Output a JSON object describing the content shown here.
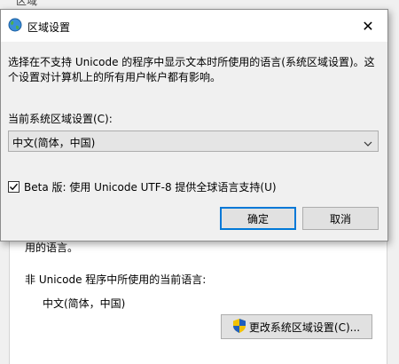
{
  "background_window": {
    "title": "区域",
    "wrapped_text": "用的语言。",
    "non_unicode_label": "非 Unicode 程序中所使用的当前语言:",
    "current_language": "中文(简体，中国)",
    "change_button": "更改系统区域设置(C)..."
  },
  "dialog": {
    "title": "区域设置",
    "description": "选择在不支持 Unicode 的程序中显示文本时所使用的语言(系统区域设置)。这个设置对计算机上的所有用户帐户都有影响。",
    "current_locale_label": "当前系统区域设置(C):",
    "current_locale_value": "中文(简体，中国)",
    "utf8_checkbox_label": "Beta 版: 使用 Unicode UTF-8 提供全球语言支持(U)",
    "utf8_checked": true,
    "ok_button": "确定",
    "cancel_button": "取消"
  },
  "colors": {
    "accent": "#0078d7",
    "shield_blue": "#1f5fbf",
    "shield_yellow": "#f2c200"
  }
}
